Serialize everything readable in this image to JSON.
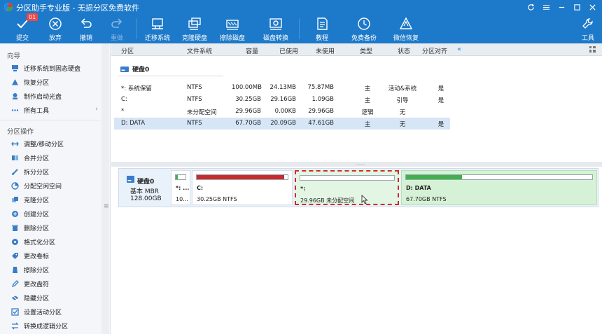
{
  "window": {
    "title": "分区助手专业版 - 无损分区免费软件"
  },
  "toolbar": {
    "badge": "01",
    "items": [
      {
        "label": "提交",
        "icon": "check-icon"
      },
      {
        "label": "放弃",
        "icon": "discard-icon"
      },
      {
        "label": "撤销",
        "icon": "undo-icon"
      },
      {
        "label": "重做",
        "icon": "redo-icon"
      },
      {
        "label": "迁移系统",
        "icon": "migrate-os-icon"
      },
      {
        "label": "克隆硬盘",
        "icon": "clone-disk-icon"
      },
      {
        "label": "擦除磁盘",
        "icon": "wipe-disk-icon"
      },
      {
        "label": "磁盘转换",
        "icon": "convert-disk-icon"
      },
      {
        "label": "教程",
        "icon": "tutorial-icon"
      },
      {
        "label": "免费备份",
        "icon": "backup-icon"
      },
      {
        "label": "微信恢复",
        "icon": "recover-icon"
      },
      {
        "label": "工具",
        "icon": "tools-icon"
      }
    ]
  },
  "sidebar": {
    "wizard_title": "向导",
    "wizard_items": [
      {
        "label": "迁移系统到固态硬盘"
      },
      {
        "label": "恢复分区"
      },
      {
        "label": "制作启动光盘"
      },
      {
        "label": "所有工具",
        "chevron": "›"
      }
    ],
    "ops_title": "分区操作",
    "ops_items": [
      {
        "label": "调整/移动分区"
      },
      {
        "label": "合并分区"
      },
      {
        "label": "拆分分区"
      },
      {
        "label": "分配空闲空间"
      },
      {
        "label": "克隆分区"
      },
      {
        "label": "创建分区"
      },
      {
        "label": "删除分区"
      },
      {
        "label": "格式化分区"
      },
      {
        "label": "更改卷标"
      },
      {
        "label": "擦除分区"
      },
      {
        "label": "更改盘符"
      },
      {
        "label": "隐藏分区"
      },
      {
        "label": "设置活动分区"
      },
      {
        "label": "转换成逻辑分区"
      }
    ],
    "scroll_grip": "≡"
  },
  "table": {
    "headers": [
      "分区",
      "文件系统",
      "容量",
      "已使用",
      "未使用",
      "类型",
      "状态",
      "分区对齐"
    ],
    "collapse_glyph": "«",
    "disk_label": "硬盘0",
    "rows": [
      {
        "partition": "*: 系统保留",
        "fs": "NTFS",
        "capacity": "100.00MB",
        "used": "24.13MB",
        "free": "75.87MB",
        "type": "主",
        "status": "活动&系统",
        "align": "是"
      },
      {
        "partition": "C:",
        "fs": "NTFS",
        "capacity": "30.25GB",
        "used": "29.16GB",
        "free": "1.09GB",
        "type": "主",
        "status": "引导",
        "align": "是"
      },
      {
        "partition": "*",
        "fs": "未分配空间",
        "capacity": "29.96GB",
        "used": "0.00KB",
        "free": "29.96GB",
        "type": "逻辑",
        "status": "无",
        "align": ""
      },
      {
        "partition": "D: DATA",
        "fs": "NTFS",
        "capacity": "67.70GB",
        "used": "20.09GB",
        "free": "47.61GB",
        "type": "主",
        "status": "无",
        "align": "是"
      }
    ],
    "splitter_dots": "....."
  },
  "diskmap": {
    "name": "硬盘0",
    "type": "基本 MBR",
    "size": "128.00GB",
    "colors": {
      "used_red": "#cc2a2a",
      "used_green": "#3fb24a",
      "used_small": "#3fb24a"
    },
    "partitions": [
      {
        "label": "*: ...",
        "desc": "10...",
        "used_pct": 24
      },
      {
        "label": "C:",
        "desc": "30.25GB NTFS",
        "used_pct": 96
      },
      {
        "label": "*:",
        "desc": "29.96GB 未分配空间",
        "used_pct": 0
      },
      {
        "label": "D: DATA",
        "desc": "67.70GB NTFS",
        "used_pct": 30
      }
    ]
  }
}
